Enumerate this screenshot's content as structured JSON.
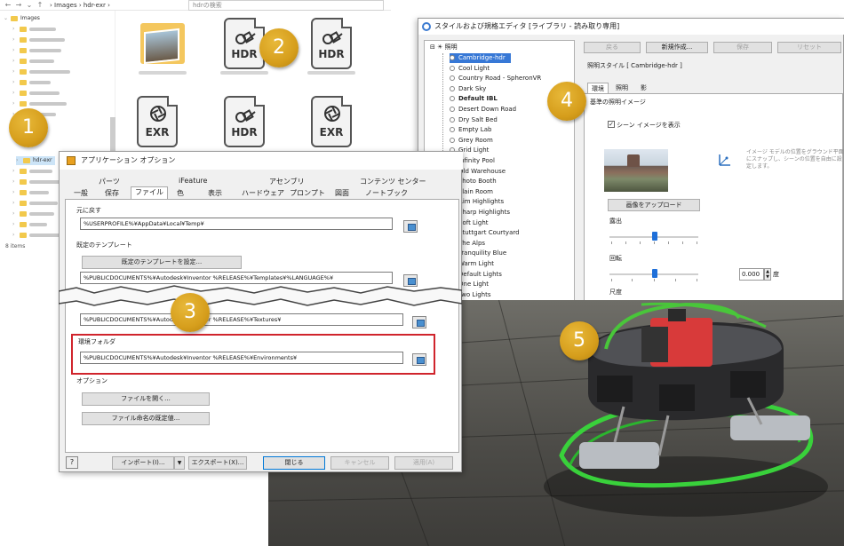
{
  "explorer": {
    "path": "› Images › hdr-exr ›",
    "search_placeholder": "hdrの検索",
    "tree_root": "Images",
    "selected_folder": "hdr-exr",
    "items_count": "8 items",
    "files": [
      {
        "kind": "folder"
      },
      {
        "kind": "hdr",
        "label": "HDR"
      },
      {
        "kind": "hdr",
        "label": "HDR"
      },
      {
        "kind": "exr",
        "label": "EXR"
      },
      {
        "kind": "hdr",
        "label": "HDR"
      },
      {
        "kind": "exr",
        "label": "EXR"
      }
    ]
  },
  "style_editor": {
    "title": "スタイルおよび規格エディタ [ライブラリ - 読み取り専用]",
    "tree_root": "照明",
    "items": [
      "Cambridge-hdr",
      "Cool Light",
      "Country Road - SpheronVR",
      "Dark Sky",
      "Default IBL",
      "Desert Down Road",
      "Dry Salt Bed",
      "Empty Lab",
      "Grey Room",
      "Grid Light",
      "Infinity Pool",
      "Old Warehouse",
      "Photo Booth",
      "Plain Room",
      "Rim Highlights",
      "Sharp Highlights",
      "Soft Light",
      "Stuttgart Courtyard",
      "The Alps",
      "Tranquility Blue",
      "Warm Light",
      "Default Lights",
      "One Light",
      "Two Lights"
    ],
    "toolbar": {
      "back": "戻る",
      "new": "新規作成...",
      "save": "保存",
      "reset": "リセット"
    },
    "lighting_style": "照明スタイル [ Cambridge-hdr ]",
    "tabs": [
      "環境",
      "照明",
      "影"
    ],
    "env_image_label": "基準の照明イメージ",
    "show_scene_image": "シーン イメージを表示",
    "upload_button": "画像をアップロード",
    "exposure_label": "露出",
    "rotation_label": "回転",
    "rotation_value": "0.000",
    "degree_unit": "度",
    "scale_label": "尺度",
    "hint": "イメージ モデルの位置をグラウンド平面にスナップし、シーンの位置を自由に設定します。"
  },
  "app_options": {
    "title": "アプリケーション オプション",
    "tabs_top": [
      "パーツ",
      "iFeature",
      "アセンブリ",
      "コンテンツ センター"
    ],
    "tabs": [
      "一般",
      "保存",
      "ファイル",
      "色",
      "表示",
      "ハードウェア",
      "プロンプト",
      "図面",
      "ノートブック"
    ],
    "undo_label": "元に戻す",
    "undo_path": "%USERPROFILE%¥AppData¥Local¥Temp¥",
    "template_label": "既定のテンプレート",
    "template_button": "既定のテンプレートを設定...",
    "template_path": "%PUBLICDOCUMENTS%¥Autodesk¥Inventor %RELEASE%¥Templates¥%LANGUAGE%¥",
    "textures_path": "%PUBLICDOCUMENTS%¥Autodesk¥Inventor %RELEASE%¥Textures¥",
    "env_folder_label": "環境フォルダ",
    "env_folder_path": "%PUBLICDOCUMENTS%¥Autodesk¥Inventor %RELEASE%¥Environments¥",
    "options_label": "オプション",
    "file_open_button": "ファイルを開く...",
    "filename_default_button": "ファイル命名の既定値...",
    "import_button": "インポート(I)...",
    "export_button": "エクスポート(X)...",
    "close_button": "閉じる",
    "cancel_button": "キャンセル",
    "apply_button": "適用(A)"
  },
  "callouts": [
    "1",
    "2",
    "3",
    "4",
    "5"
  ]
}
